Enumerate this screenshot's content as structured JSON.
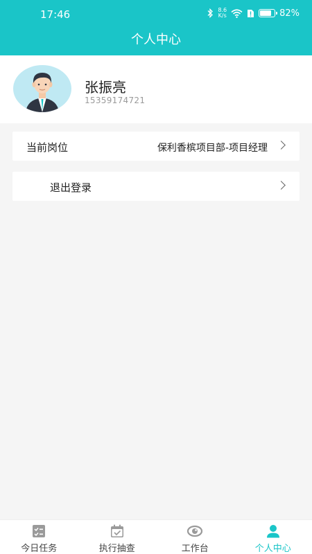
{
  "status_bar": {
    "time": "17:46",
    "net_speed_top": "8.6",
    "net_speed_bottom": "K/s",
    "battery": "82%",
    "battery_level": 0.82
  },
  "header": {
    "title": "个人中心"
  },
  "profile": {
    "name": "张振亮",
    "phone": "15359174721"
  },
  "menu": {
    "position": {
      "label": "当前岗位",
      "value": "保利香槟项目部-项目经理"
    },
    "logout": {
      "label": "退出登录"
    }
  },
  "tabs": [
    {
      "label": "今日任务",
      "icon": "task-list-icon",
      "active": false
    },
    {
      "label": "执行抽查",
      "icon": "calendar-check-icon",
      "active": false
    },
    {
      "label": "工作台",
      "icon": "workbench-eye-icon",
      "active": false
    },
    {
      "label": "个人中心",
      "icon": "user-icon",
      "active": true
    }
  ],
  "colors": {
    "accent": "#1ac5c8",
    "background": "#f5f5f5",
    "inactive_icon": "#999999"
  }
}
